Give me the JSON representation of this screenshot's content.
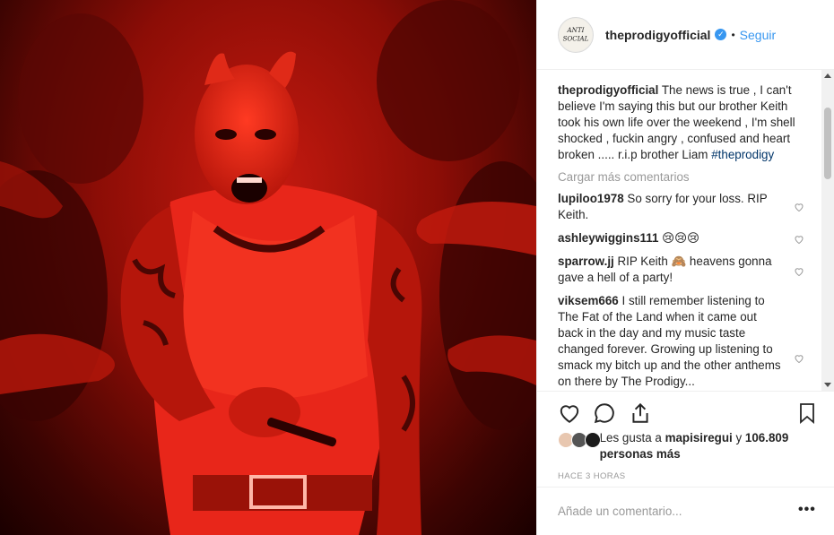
{
  "post": {
    "photo_icon": "post-photo",
    "owner": {
      "username": "theprodigyofficial",
      "verified_icon": "verified-badge-icon",
      "verified_glyph": "✓",
      "separator": "•",
      "follow_label": "Seguir",
      "avatar_text_1": "ANTI",
      "avatar_text_2": "SOCIAL"
    },
    "caption": {
      "username": "theprodigyofficial",
      "text": "The news is true , I can't believe I'm saying this but our brother Keith took his own life over the weekend , I'm shell shocked , fuckin angry , confused and heart broken ..... r.i.p brother Liam",
      "hashtag": "#theprodigy"
    },
    "load_more_label": "Cargar más comentarios",
    "comments": [
      {
        "username": "lupiloo1978",
        "text": "So sorry for your loss. RIP Keith."
      },
      {
        "username": "ashleywiggins111",
        "text": "😢😢😢"
      },
      {
        "username": "sparrow.jj",
        "text": "RIP Keith 🙈 heavens gonna gave a hell of a party!"
      },
      {
        "username": "viksem666",
        "text": "I still remember listening to The Fat of the Land when it came out back in the day and my music taste changed forever. Growing up listening to smack my bitch up and the other anthems on there by The Prodigy..."
      }
    ],
    "likes": {
      "prefix": "Les gusta a ",
      "first_user": "mapisiregui",
      "middle": " y ",
      "count": "106.809 personas más"
    },
    "timestamp": "HACE 3 HORAS",
    "add_comment_placeholder": "Añade un comentario...",
    "more_options_label": "•••"
  },
  "colors": {
    "accent": "#3897f0",
    "hashtag": "#003569",
    "muted": "#999999",
    "photo_red": "#c61a10"
  }
}
